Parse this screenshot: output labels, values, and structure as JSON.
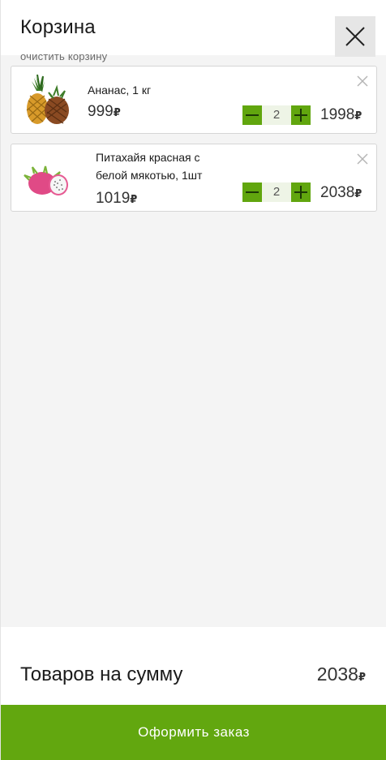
{
  "header": {
    "title": "Корзина",
    "clear_label": "очистить корзину"
  },
  "currency_symbol": "₽",
  "items": [
    {
      "name": "Ананас, 1 кг",
      "price": "999",
      "quantity": "2",
      "total": "1998",
      "image": "pineapple-image"
    },
    {
      "name": "Питахайя красная с белой мякотью, 1шт",
      "price": "1019",
      "quantity": "2",
      "total": "2038",
      "image": "dragonfruit-image"
    }
  ],
  "footer": {
    "sum_label": "Товаров на сумму",
    "sum_value": "2038",
    "checkout_label": "Оформить заказ"
  },
  "colors": {
    "accent": "#62a70f",
    "stepper_bg": "#eef4e6"
  }
}
